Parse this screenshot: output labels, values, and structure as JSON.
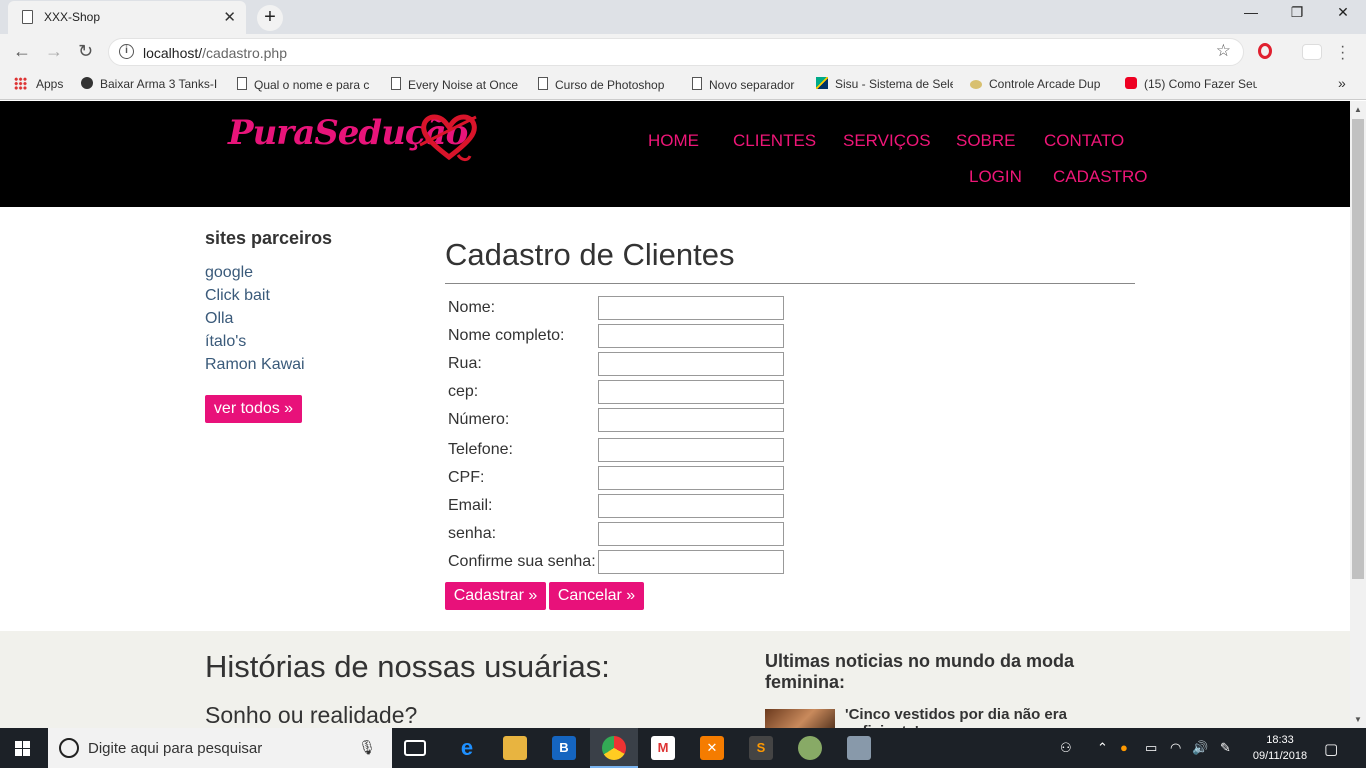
{
  "browser": {
    "tab_title": "XXX-Shop",
    "tab_close": "✕",
    "new_tab": "+",
    "url_host": "localhost/",
    "url_path": "/cadastro.php",
    "window": {
      "minimize": "—",
      "restore": "❐",
      "close": "✕"
    }
  },
  "bookmarks": [
    {
      "label": "Apps",
      "icon": "apps-grid-icon"
    },
    {
      "label": "Baixar Arma 3 Tanks-I",
      "icon": "skull-icon"
    },
    {
      "label": "Qual o nome e para c",
      "icon": "page-icon"
    },
    {
      "label": "Every Noise at Once",
      "icon": "page-icon"
    },
    {
      "label": "Curso de Photoshop",
      "icon": "page-icon"
    },
    {
      "label": "Novo separador",
      "icon": "page-icon"
    },
    {
      "label": "Sisu - Sistema de Sele",
      "icon": "flag-icon"
    },
    {
      "label": "Controle Arcade Dup",
      "icon": "controller-icon"
    },
    {
      "label": "(15) Como Fazer Seu",
      "icon": "youtube-icon"
    }
  ],
  "bookmarks_more": "»",
  "site": {
    "logo": "PuraSedução",
    "nav": [
      "HOME",
      "CLIENTES",
      "SERVIÇOS",
      "SOBRE",
      "CONTATO",
      "LOGIN",
      "CADASTRO"
    ],
    "accent": "#ef1678"
  },
  "sidebar": {
    "title": "sites parceiros",
    "links": [
      "google",
      "Click bait",
      "Olla",
      "ítalo's",
      "Ramon Kawai"
    ],
    "more_button": "ver todos »"
  },
  "form": {
    "title": "Cadastro de Clientes",
    "fields": [
      "Nome:",
      "Nome completo:",
      "Rua:",
      "cep:",
      "Número:",
      "Telefone:",
      "CPF:",
      "Email:",
      "senha:",
      "Confirme sua senha:"
    ],
    "submit": "Cadastrar »",
    "cancel": "Cancelar »"
  },
  "footer": {
    "stories_title": "Histórias de nossas usuárias:",
    "stories_sub": "Sonho ou realidade?",
    "news_title": "Ultimas noticias no mundo da moda feminina:",
    "news_item": "'Cinco vestidos por dia não era suficiente',"
  },
  "taskbar": {
    "search_placeholder": "Digite aqui para pesquisar",
    "time": "18:33",
    "date": "09/11/2018"
  }
}
